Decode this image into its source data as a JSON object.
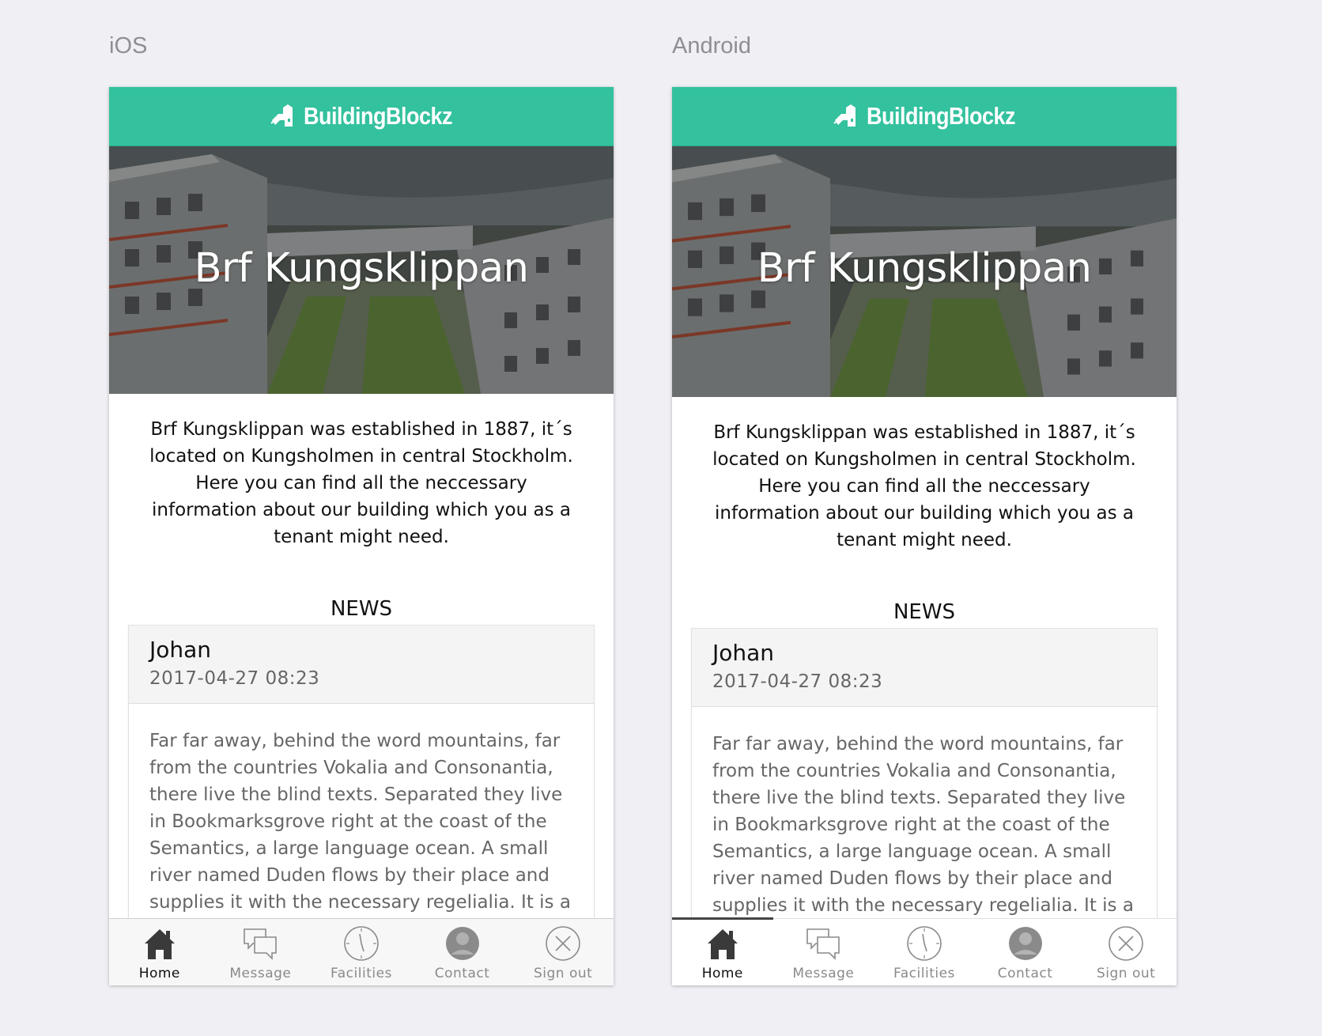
{
  "platforms": [
    {
      "label": "iOS",
      "brand": "BuildingBlockz",
      "hero_title": "Brf Kungsklippan",
      "intro": "Brf Kungsklippan was established in 1887, it´s located on Kungsholmen in central Stockholm. Here you can find all the neccessary information about our building which you as a tenant might need.",
      "news_heading": "NEWS",
      "news": {
        "author": "Johan",
        "date": "2017-04-27 08:23",
        "body": "Far far away, behind the word mountains, far from the countries Vokalia and Consonantia, there live the blind texts. Separated they live in Bookmarksgrove right at the coast of the Semantics, a large language ocean. A small river named Duden flows by their place and supplies it with the necessary regelialia. It is a"
      },
      "tabs": [
        {
          "label": "Home",
          "icon": "home-icon",
          "active": true
        },
        {
          "label": "Message",
          "icon": "message-icon",
          "active": false
        },
        {
          "label": "Facilities",
          "icon": "clock-icon",
          "active": false
        },
        {
          "label": "Contact",
          "icon": "person-icon",
          "active": false
        },
        {
          "label": "Sign out",
          "icon": "close-circle-icon",
          "active": false
        }
      ]
    },
    {
      "label": "Android",
      "brand": "BuildingBlockz",
      "hero_title": "Brf Kungsklippan",
      "intro": "Brf Kungsklippan was established in 1887, it´s located on Kungsholmen in central Stockholm. Here you can find all the neccessary information about our building which you as a tenant might need.",
      "news_heading": "NEWS",
      "news": {
        "author": "Johan",
        "date": "2017-04-27 08:23",
        "body": "Far far away, behind the word mountains, far from the countries Vokalia and Consonantia, there live the blind texts. Separated they live in Bookmarksgrove right at the coast of the Semantics, a large language ocean. A small river named Duden flows by their place and supplies it with the necessary regelialia. It is a"
      },
      "tabs": [
        {
          "label": "Home",
          "icon": "home-icon",
          "active": true
        },
        {
          "label": "Message",
          "icon": "message-icon",
          "active": false
        },
        {
          "label": "Facilities",
          "icon": "clock-icon",
          "active": false
        },
        {
          "label": "Contact",
          "icon": "person-icon",
          "active": false
        },
        {
          "label": "Sign out",
          "icon": "close-circle-icon",
          "active": false
        }
      ]
    }
  ],
  "colors": {
    "brand": "#33c19e",
    "background": "#efeff4"
  }
}
